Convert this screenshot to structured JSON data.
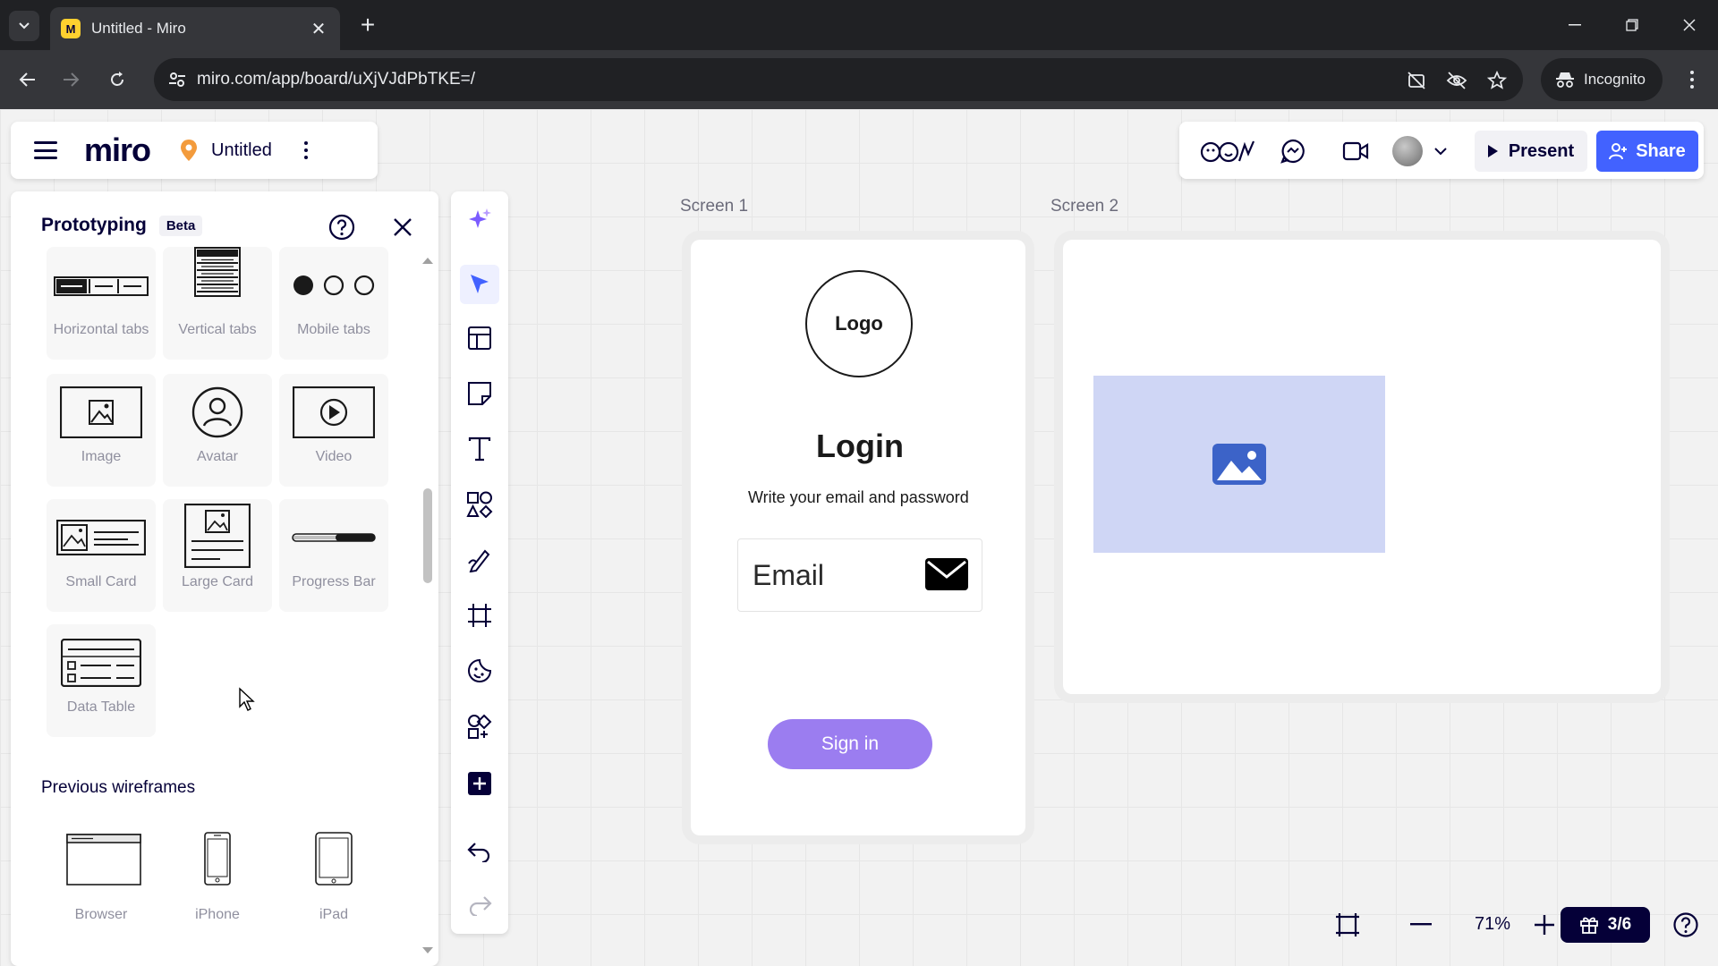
{
  "browser": {
    "tab_title": "Untitled - Miro",
    "favicon_letter": "M",
    "url": "miro.com/app/board/uXjVJdPbTKE=/",
    "incognito_label": "Incognito"
  },
  "board": {
    "logo": "miro",
    "name": "Untitled"
  },
  "header": {
    "present_label": "Present",
    "share_label": "Share"
  },
  "prototyping": {
    "title": "Prototyping",
    "badge": "Beta",
    "widgets": [
      {
        "label": "Horizontal tabs",
        "icon": "horizontal-tabs-icon"
      },
      {
        "label": "Vertical tabs",
        "icon": "vertical-tabs-icon"
      },
      {
        "label": "Mobile tabs",
        "icon": "mobile-tabs-icon"
      },
      {
        "label": "Image",
        "icon": "image-icon"
      },
      {
        "label": "Avatar",
        "icon": "avatar-icon"
      },
      {
        "label": "Video",
        "icon": "video-icon"
      },
      {
        "label": "Small Card",
        "icon": "small-card-icon"
      },
      {
        "label": "Large Card",
        "icon": "large-card-icon"
      },
      {
        "label": "Progress Bar",
        "icon": "progress-bar-icon"
      },
      {
        "label": "Data Table",
        "icon": "data-table-icon"
      }
    ],
    "previous_title": "Previous wireframes",
    "previous": [
      {
        "label": "Browser",
        "icon": "browser-frame-icon"
      },
      {
        "label": "iPhone",
        "icon": "iphone-frame-icon"
      },
      {
        "label": "iPad",
        "icon": "ipad-frame-icon"
      }
    ]
  },
  "frames": {
    "screen1": {
      "label": "Screen 1",
      "logo_text": "Logo",
      "title": "Login",
      "subtitle": "Write your email and password",
      "email_placeholder": "Email",
      "signin_label": "Sign in"
    },
    "screen2": {
      "label": "Screen 2"
    }
  },
  "zoom": {
    "value": "71%",
    "pages": "3/6"
  },
  "colors": {
    "accent": "#4262ff",
    "signin": "#9b7df0",
    "placeholder": "#cfd6f5",
    "image_icon": "#3c63c8"
  }
}
